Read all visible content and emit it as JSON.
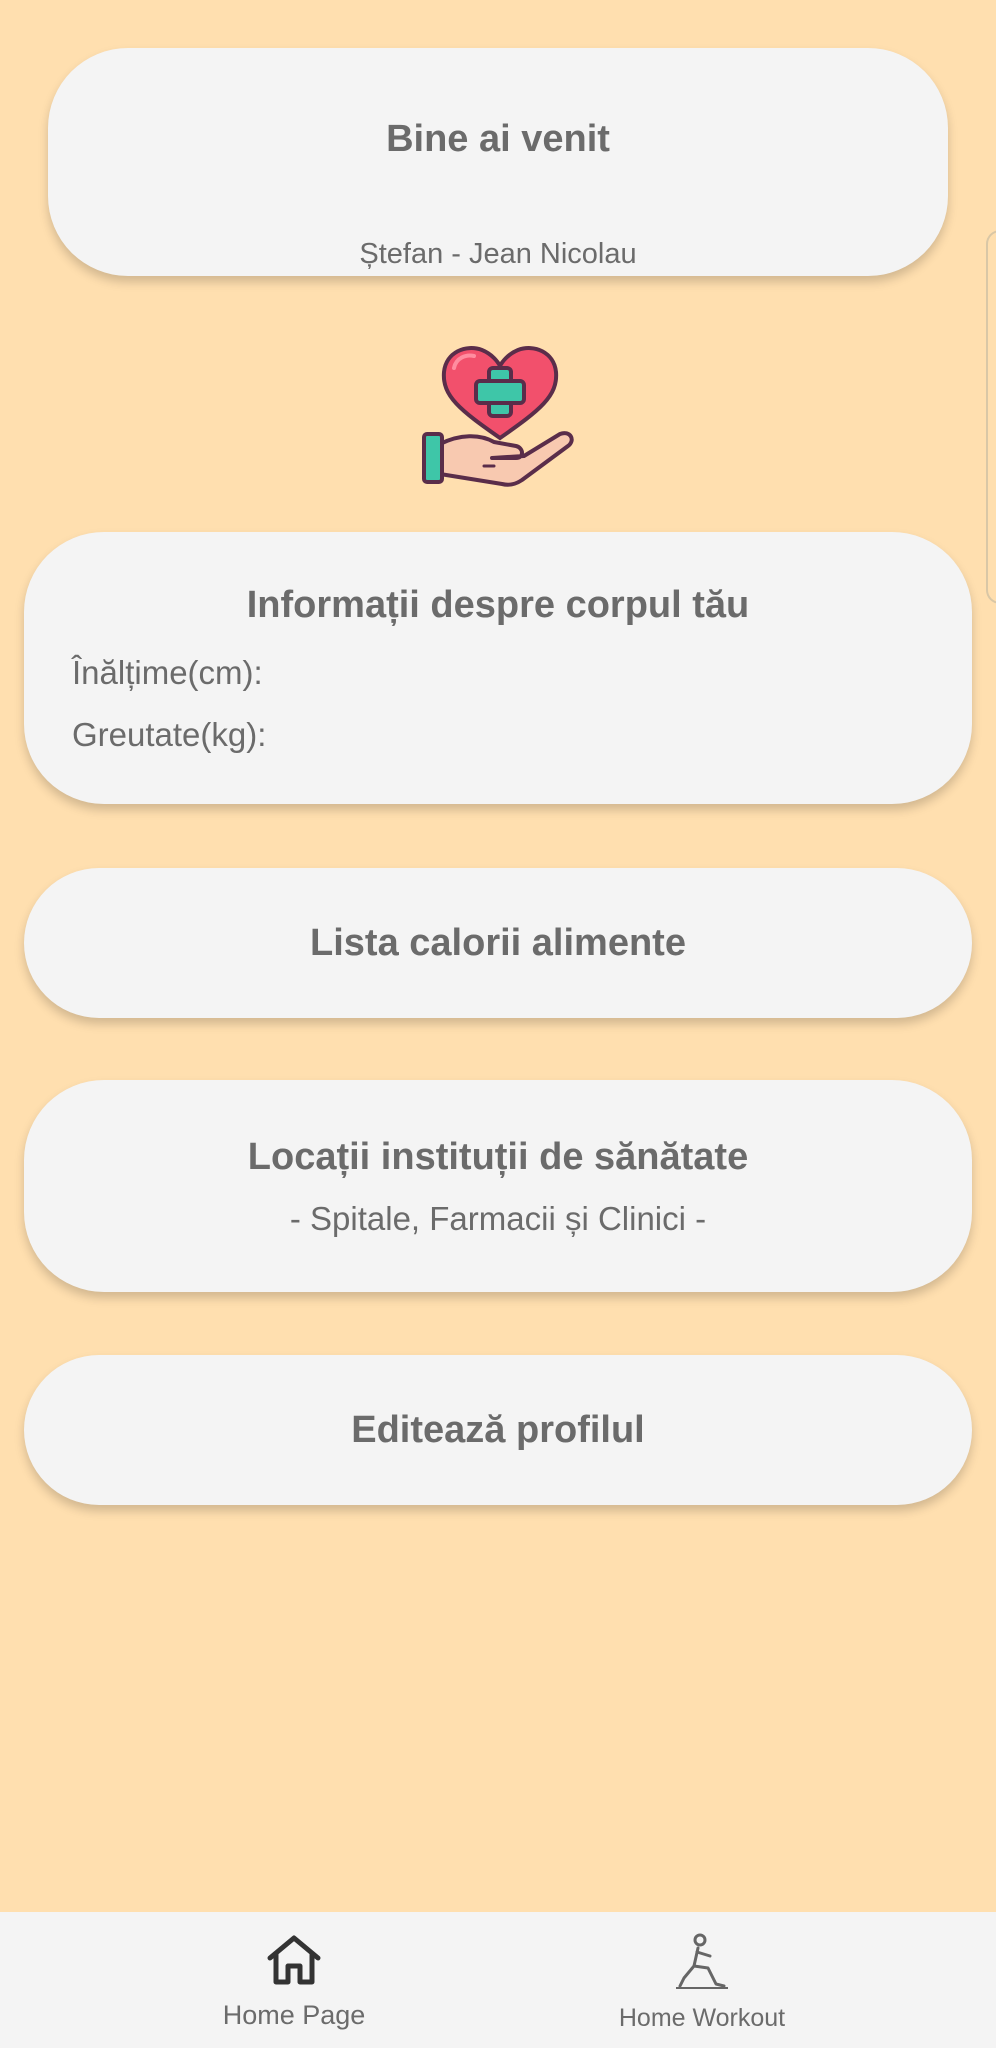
{
  "welcome": {
    "title": "Bine ai venit",
    "user_name": "Ștefan - Jean Nicolau"
  },
  "logo": {
    "icon": "heart-care-hand-icon"
  },
  "body_info": {
    "title": "Informații despre corpul tău",
    "height_label": "Înălțime(cm):",
    "weight_label": "Greutate(kg):"
  },
  "buttons": {
    "calories": "Lista calorii alimente",
    "locations_title": "Locații instituții de sănătate",
    "locations_sub": "- Spitale, Farmacii și Clinici -",
    "edit_profile": "Editează profilul"
  },
  "nav": {
    "items": [
      {
        "label": "Home Page",
        "icon": "home-icon"
      },
      {
        "label": "Home Workout",
        "icon": "workout-icon"
      }
    ]
  },
  "colors": {
    "background": "#FFDFAF",
    "card": "#F4F4F4",
    "text": "#6B6B6B",
    "heart": "#F2506C",
    "cross": "#3EC6A8"
  }
}
